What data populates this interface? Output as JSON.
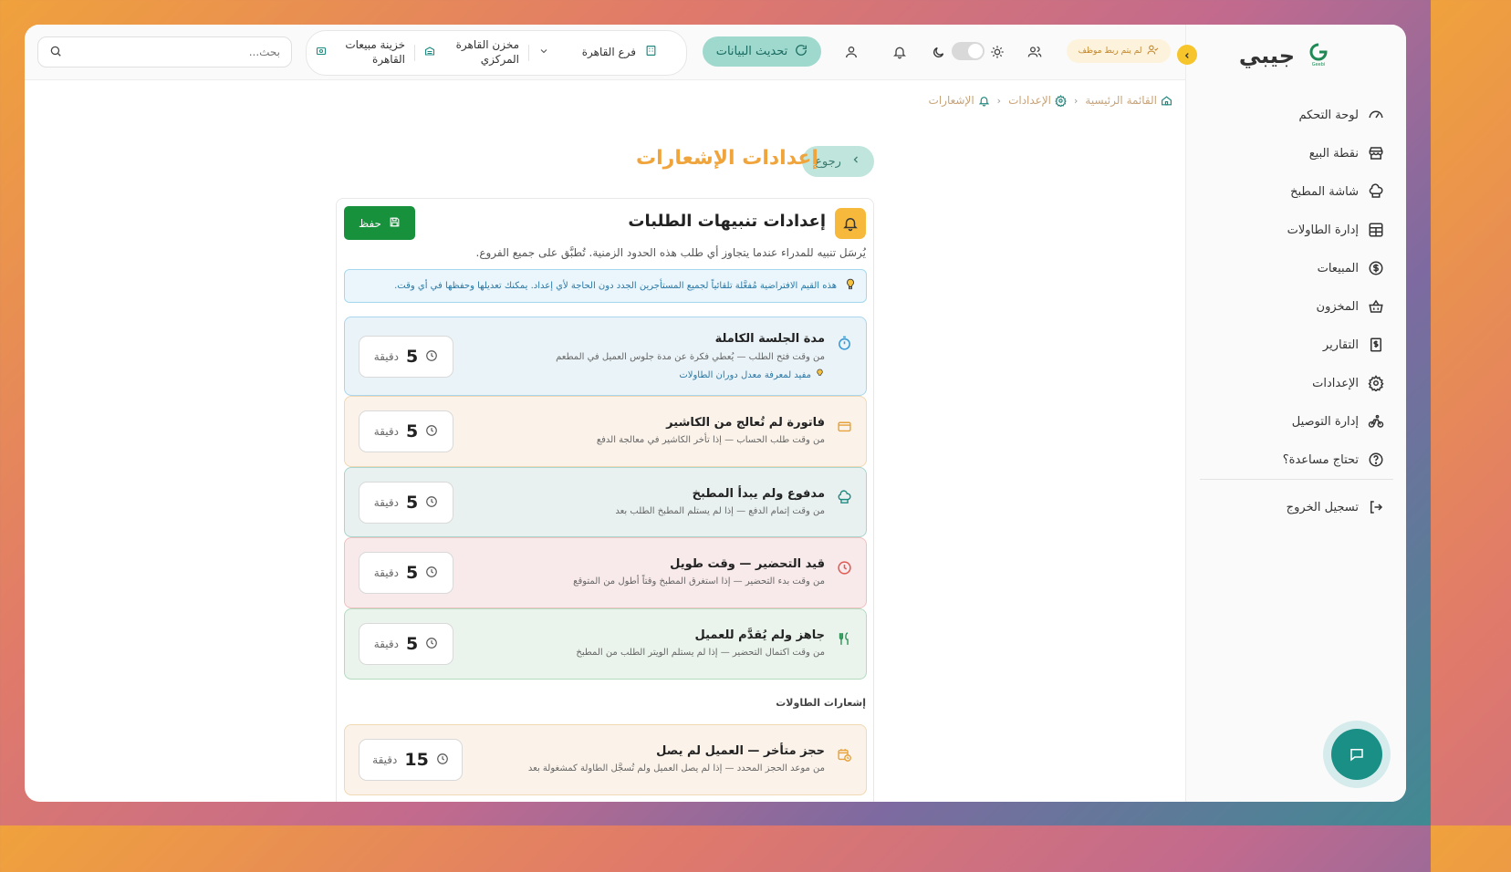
{
  "sidebar": {
    "brand": "جيبي",
    "logo_text": "Geebi",
    "items": [
      {
        "label": "لوحة التحكم",
        "icon": "gauge-icon"
      },
      {
        "label": "نقطة البيع",
        "icon": "store-icon"
      },
      {
        "label": "شاشة المطبخ",
        "icon": "chef-hat-icon"
      },
      {
        "label": "إدارة الطاولات",
        "icon": "table-grid-icon"
      },
      {
        "label": "المبيعات",
        "icon": "dollar-circle-icon"
      },
      {
        "label": "المخزون",
        "icon": "basket-icon"
      },
      {
        "label": "التقارير",
        "icon": "receipt-dollar-icon"
      },
      {
        "label": "الإعدادات",
        "icon": "gear-icon"
      },
      {
        "label": "إدارة التوصيل",
        "icon": "bike-icon"
      },
      {
        "label": "تحتاج مساعدة؟",
        "icon": "help-circle-icon"
      }
    ],
    "logout": "تسجيل الخروج"
  },
  "header": {
    "search_placeholder": "بحث...",
    "branch": "فرع القاهرة",
    "warehouse": "مخزن القاهرة المركزي",
    "treasury": "خزينة مبيعات القاهرة",
    "refresh": "تحديث البيانات",
    "employee_badge": "لم يتم ربط موظف"
  },
  "breadcrumb": {
    "home": "القائمة الرئيسية",
    "settings": "الإعدادات",
    "current": "الإشعارات"
  },
  "page": {
    "back": "رجوع",
    "title": "إعدادات الإشعارات"
  },
  "card": {
    "title": "إعدادات تنبيهات الطلبات",
    "save": "حفظ",
    "description": "يُرسَل تنبيه للمدراء عندما يتجاوز أي طلب هذه الحدود الزمنية. تُطبَّق على جميع الفروع.",
    "note": "هذه القيم الافتراضية مُفعَّلة تلقائياً لجميع المستأجرين الجدد دون الحاجة لأي إعداد. يمكنك تعديلها وحفظها في أي وقت.",
    "unit": "دقيقة",
    "order_alerts": [
      {
        "title": "مدة الجلسة الكاملة",
        "sub": "من وقت فتح الطلب — يُعطي فكرة عن مدة جلوس العميل في المطعم",
        "tip": "مفيد لمعرفة معدل دوران الطاولات",
        "value": "5",
        "icon": "stopwatch-icon",
        "color": "#3b9ad4"
      },
      {
        "title": "فاتورة لم تُعالج من الكاشير",
        "sub": "من وقت طلب الحساب — إذا تأخر الكاشير في معالجة الدفع",
        "value": "5",
        "icon": "credit-card-icon",
        "color": "#e6a23c"
      },
      {
        "title": "مدفوع ولم يبدأ المطبخ",
        "sub": "من وقت إتمام الدفع — إذا لم يستلم المطبخ الطلب بعد",
        "value": "5",
        "icon": "chef-hat-icon",
        "color": "#1f8a80"
      },
      {
        "title": "قيد التحضير — وقت طويل",
        "sub": "من وقت بدء التحضير — إذا استغرق المطبخ وقتاً أطول من المتوقع",
        "value": "5",
        "icon": "clock-icon",
        "color": "#e05a55"
      },
      {
        "title": "جاهز ولم يُقدَّم للعميل",
        "sub": "من وقت اكتمال التحضير — إذا لم يستلم الويتر الطلب من المطبخ",
        "value": "5",
        "icon": "utensils-icon",
        "color": "#2a9455"
      }
    ],
    "tables_section": "إشعارات الطاولات",
    "table_alerts": [
      {
        "title": "حجز متأخر — العميل لم يصل",
        "sub": "من موعد الحجز المحدد — إذا لم يصل العميل ولم تُسجَّل الطاولة كمشغولة بعد",
        "value": "15",
        "icon": "calendar-clock-icon",
        "color": "#e6a23c"
      }
    ]
  }
}
